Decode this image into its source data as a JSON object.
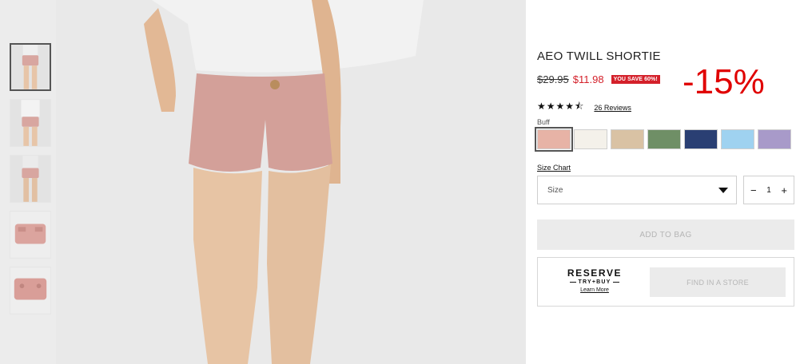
{
  "product": {
    "title": "AEO TWILL SHORTIE",
    "old_price": "$29.95",
    "new_price": "$11.98",
    "save_badge": "YOU SAVE 60%!",
    "discount_overlay": "-15%",
    "rating": {
      "stars": "★★★★⯪",
      "value": 4.5,
      "reviews_label": "26 Reviews"
    }
  },
  "colors": {
    "label": "Buff",
    "swatches": [
      {
        "name": "buff",
        "hex": "#e7b3a6",
        "selected": true
      },
      {
        "name": "white",
        "hex": "#f4f1ea"
      },
      {
        "name": "tan",
        "hex": "#d9c2a4"
      },
      {
        "name": "olive",
        "hex": "#6f8f66"
      },
      {
        "name": "navy",
        "hex": "#2a3f73"
      },
      {
        "name": "light-blue",
        "hex": "#9fd2f0"
      },
      {
        "name": "lavender",
        "hex": "#a89ac9"
      }
    ]
  },
  "size": {
    "chart_label": "Size Chart",
    "placeholder": "Size"
  },
  "quantity": {
    "minus": "−",
    "value": "1",
    "plus": "+"
  },
  "actions": {
    "add_to_bag": "ADD TO BAG",
    "find_in_store": "FIND IN A STORE"
  },
  "reserve": {
    "word": "RESERVE",
    "tagline": "TRY+BUY",
    "learn_more": "Learn More"
  },
  "gallery": {
    "thumbnail_count": 5,
    "active_index": 0
  }
}
